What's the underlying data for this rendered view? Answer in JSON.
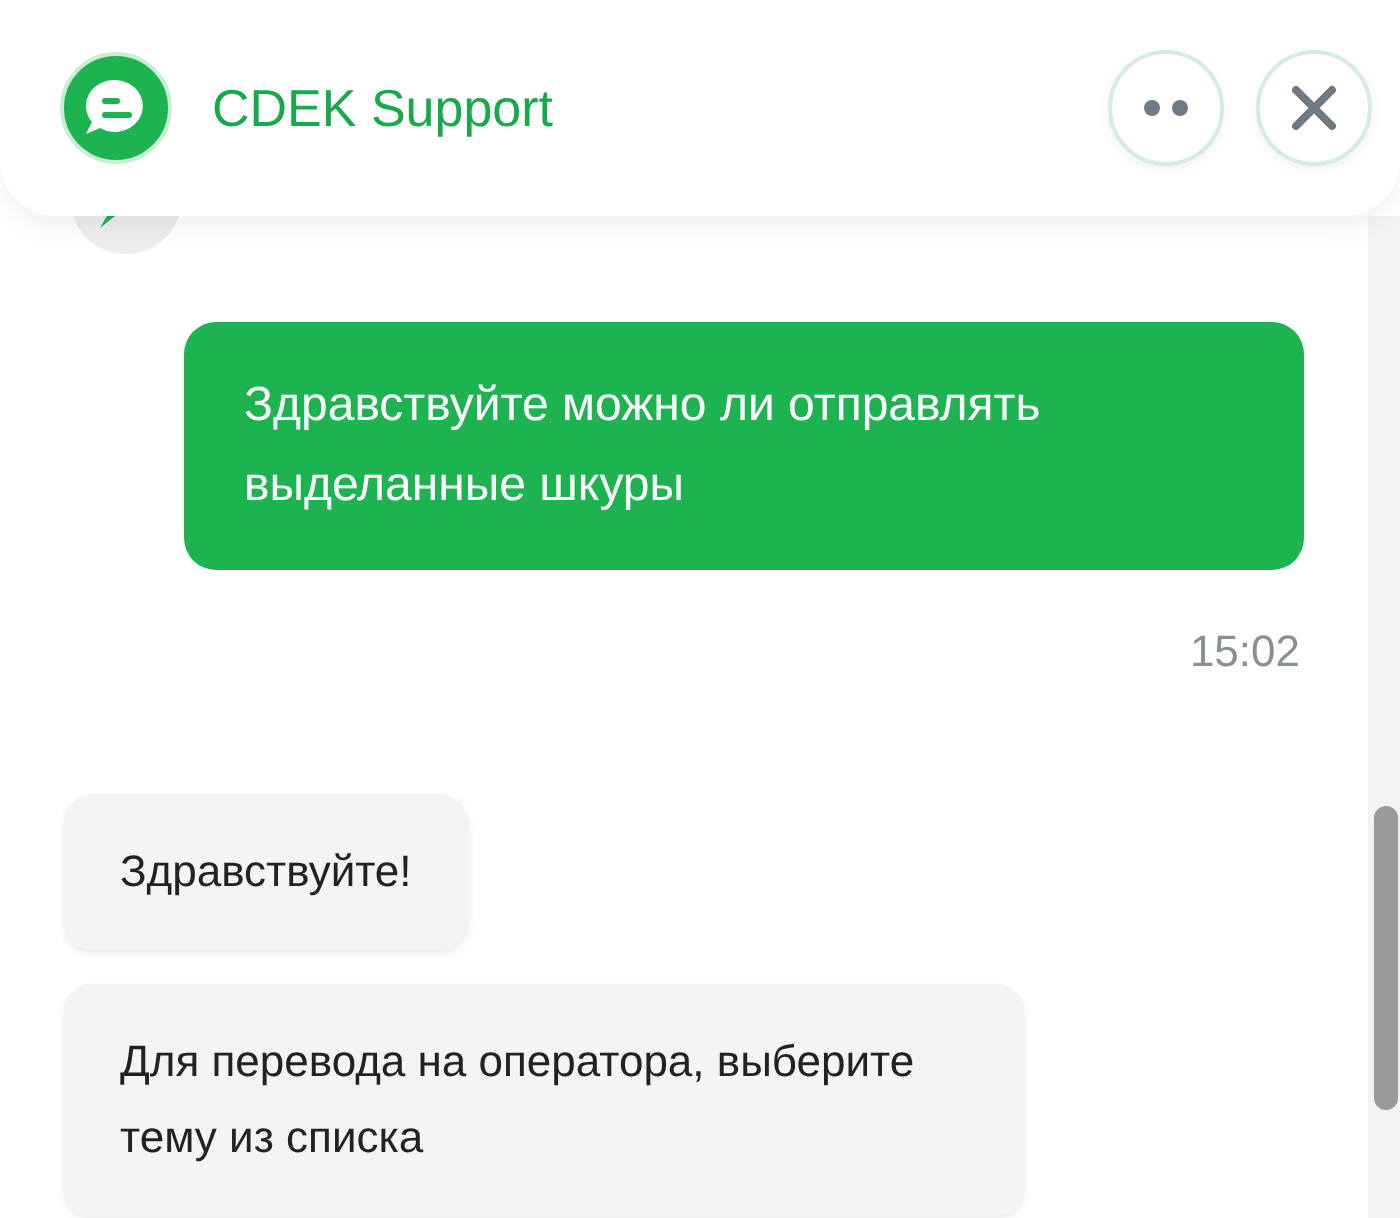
{
  "header": {
    "title": "CDEK Support"
  },
  "messages": [
    {
      "kind": "outgoing",
      "text": "Здравствуйте можно ли отправлять выделанные шкуры",
      "time": "15:02"
    },
    {
      "kind": "incoming",
      "text": "Здравствуйте!"
    },
    {
      "kind": "incoming",
      "text": "Для перевода на оператора, выберите тему из списка"
    }
  ]
}
